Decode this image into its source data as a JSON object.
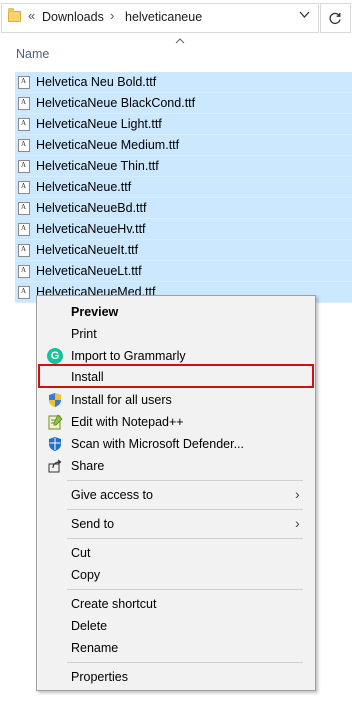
{
  "addressbar": {
    "overflow": "«",
    "crumbs": [
      "Downloads",
      "helveticaneue"
    ],
    "separator": "›",
    "dropdown_icon": "chevron-down-icon",
    "refresh_icon": "refresh-icon"
  },
  "columns": {
    "name": "Name",
    "sort_indicator": "^"
  },
  "files": [
    "Helvetica Neu Bold.ttf",
    "HelveticaNeue BlackCond.ttf",
    "HelveticaNeue Light.ttf",
    "HelveticaNeue Medium.ttf",
    "HelveticaNeue Thin.ttf",
    "HelveticaNeue.ttf",
    "HelveticaNeueBd.ttf",
    "HelveticaNeueHv.ttf",
    "HelveticaNeueIt.ttf",
    "HelveticaNeueLt.ttf",
    "HelveticaNeueMed.ttf"
  ],
  "menu": {
    "preview": "Preview",
    "print": "Print",
    "grammarly": "Import to Grammarly",
    "install": "Install",
    "install_all": "Install for all users",
    "notepad": "Edit with Notepad++",
    "defender": "Scan with Microsoft Defender...",
    "share": "Share",
    "give_access": "Give access to",
    "send_to": "Send to",
    "cut": "Cut",
    "copy": "Copy",
    "create_shortcut": "Create shortcut",
    "delete": "Delete",
    "rename": "Rename",
    "properties": "Properties",
    "submenu_arrow": "›"
  },
  "colors": {
    "selection": "#cce8ff",
    "highlight_border": "#d01010",
    "menu_bg": "#f2f2f2"
  }
}
